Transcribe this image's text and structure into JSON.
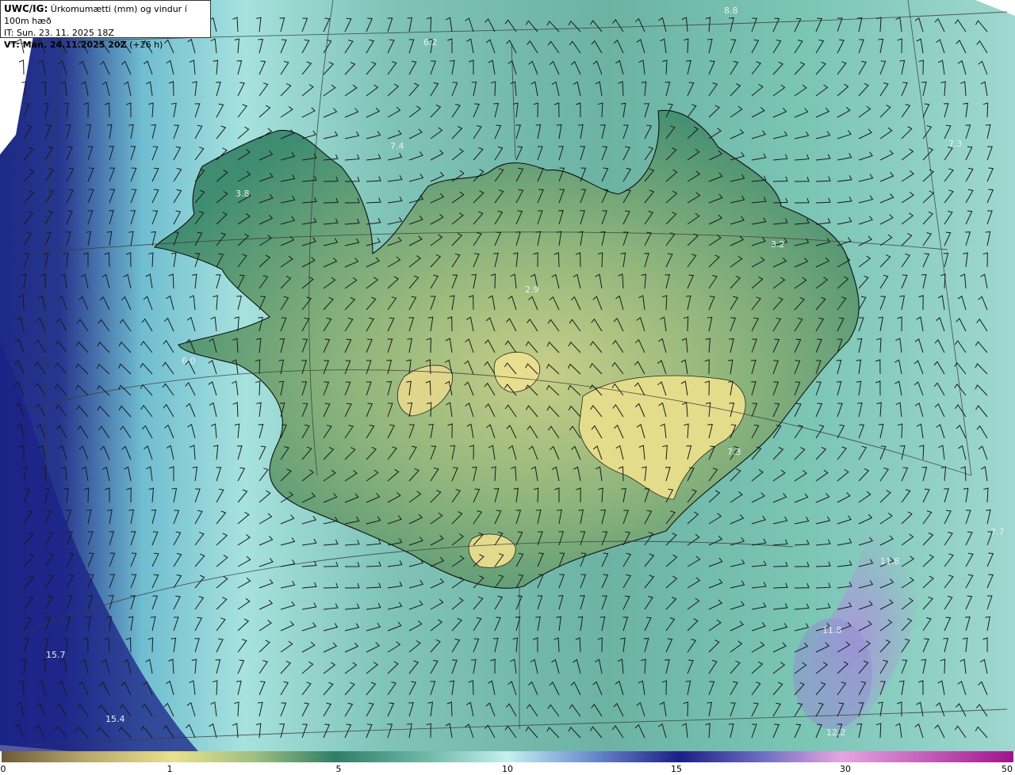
{
  "header": {
    "product_bold": "UWC/IG:",
    "product_desc": "Úrkomumætti (mm) og vindur í 100m hæð",
    "init_time": "IT: Sun. 23. 11. 2025 18Z",
    "valid_bold": "VT: Mán. 24.11.2025 20Z",
    "valid_offset": "(+26 h)"
  },
  "map": {
    "value_labels": [
      "6.2",
      "7.4",
      "3.8",
      "7.3",
      "3.2",
      "2.9",
      "6.0",
      "7.3",
      "7.7",
      "11.8",
      "11.8",
      "15.7",
      "15.4",
      "12.2",
      "8.8"
    ]
  },
  "colorbar": {
    "ticks": [
      "0",
      "1",
      "5",
      "10",
      "15",
      "30",
      "50"
    ]
  }
}
